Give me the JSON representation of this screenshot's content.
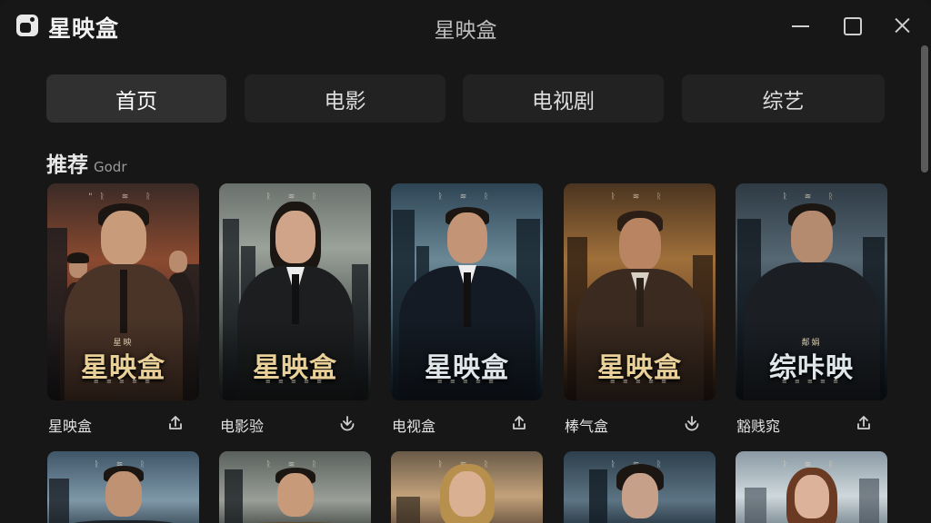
{
  "app": {
    "name": "星映盒",
    "window_title": "星映盒",
    "logo_icon": "app-logo-icon"
  },
  "window_controls": {
    "minimize_icon": "minimize-icon",
    "maximize_icon": "maximize-icon",
    "close_icon": "close-icon"
  },
  "tabs": [
    {
      "label": "首页",
      "active": true
    },
    {
      "label": "电影",
      "active": false
    },
    {
      "label": "电视剧",
      "active": false
    },
    {
      "label": "综艺",
      "active": false
    }
  ],
  "section": {
    "title": "推荐",
    "subtitle": "Godr"
  },
  "cards": [
    {
      "name": "星映盒",
      "poster_title": "星映盒",
      "poster_mini": "星映",
      "share_icon": "share-icon",
      "theme": "warm-red"
    },
    {
      "name": "电影验",
      "poster_title": "星映盒",
      "poster_mini": "",
      "share_icon": "download-icon",
      "theme": "grey-city"
    },
    {
      "name": "电视盒",
      "poster_title": "星映盒",
      "poster_mini": "",
      "share_icon": "share-icon",
      "theme": "blue-city"
    },
    {
      "name": "棒气盒",
      "poster_title": "星映盒",
      "poster_mini": "",
      "share_icon": "download-icon",
      "theme": "gold"
    },
    {
      "name": "豁贱窕",
      "poster_title": "综咔映",
      "poster_mini": "鄰娟",
      "share_icon": "share-icon",
      "theme": "dark-blue"
    }
  ],
  "row2_cards": [
    {
      "theme": "blue-city"
    },
    {
      "theme": "grey-city"
    },
    {
      "theme": "warm-sunset"
    },
    {
      "theme": "dark-blue"
    },
    {
      "theme": "bright-city"
    }
  ],
  "colors": {
    "background": "#171717",
    "tab_bg": "#222222",
    "tab_active_bg": "#303030",
    "poster_title_gold": "#e9cf98"
  }
}
